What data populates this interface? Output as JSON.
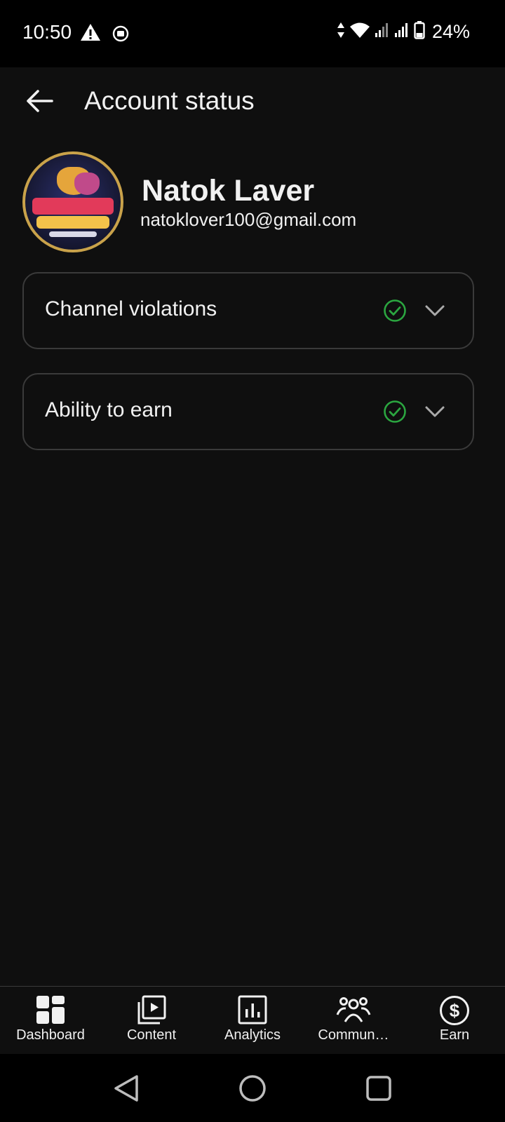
{
  "status_bar": {
    "time": "10:50",
    "battery": "24%"
  },
  "app_bar": {
    "title": "Account status"
  },
  "profile": {
    "name": "Natok Laver",
    "email": "natoklover100@gmail.com"
  },
  "status_cards": [
    {
      "label": "Channel violations",
      "icon": "check-circle-icon",
      "status_color": "#2ba640"
    },
    {
      "label": "Ability to earn",
      "icon": "check-circle-icon",
      "status_color": "#2ba640"
    }
  ],
  "bottom_nav": [
    {
      "label": "Dashboard",
      "icon": "dashboard-icon"
    },
    {
      "label": "Content",
      "icon": "content-icon"
    },
    {
      "label": "Analytics",
      "icon": "analytics-icon"
    },
    {
      "label": "Commun…",
      "icon": "community-icon"
    },
    {
      "label": "Earn",
      "icon": "earn-icon"
    }
  ],
  "system_nav": [
    "back-icon",
    "home-icon",
    "recents-icon"
  ],
  "colors": {
    "background": "#0f0f0f",
    "text": "#f1f1f1",
    "success": "#2ba640",
    "border": "#3a3a3a"
  }
}
